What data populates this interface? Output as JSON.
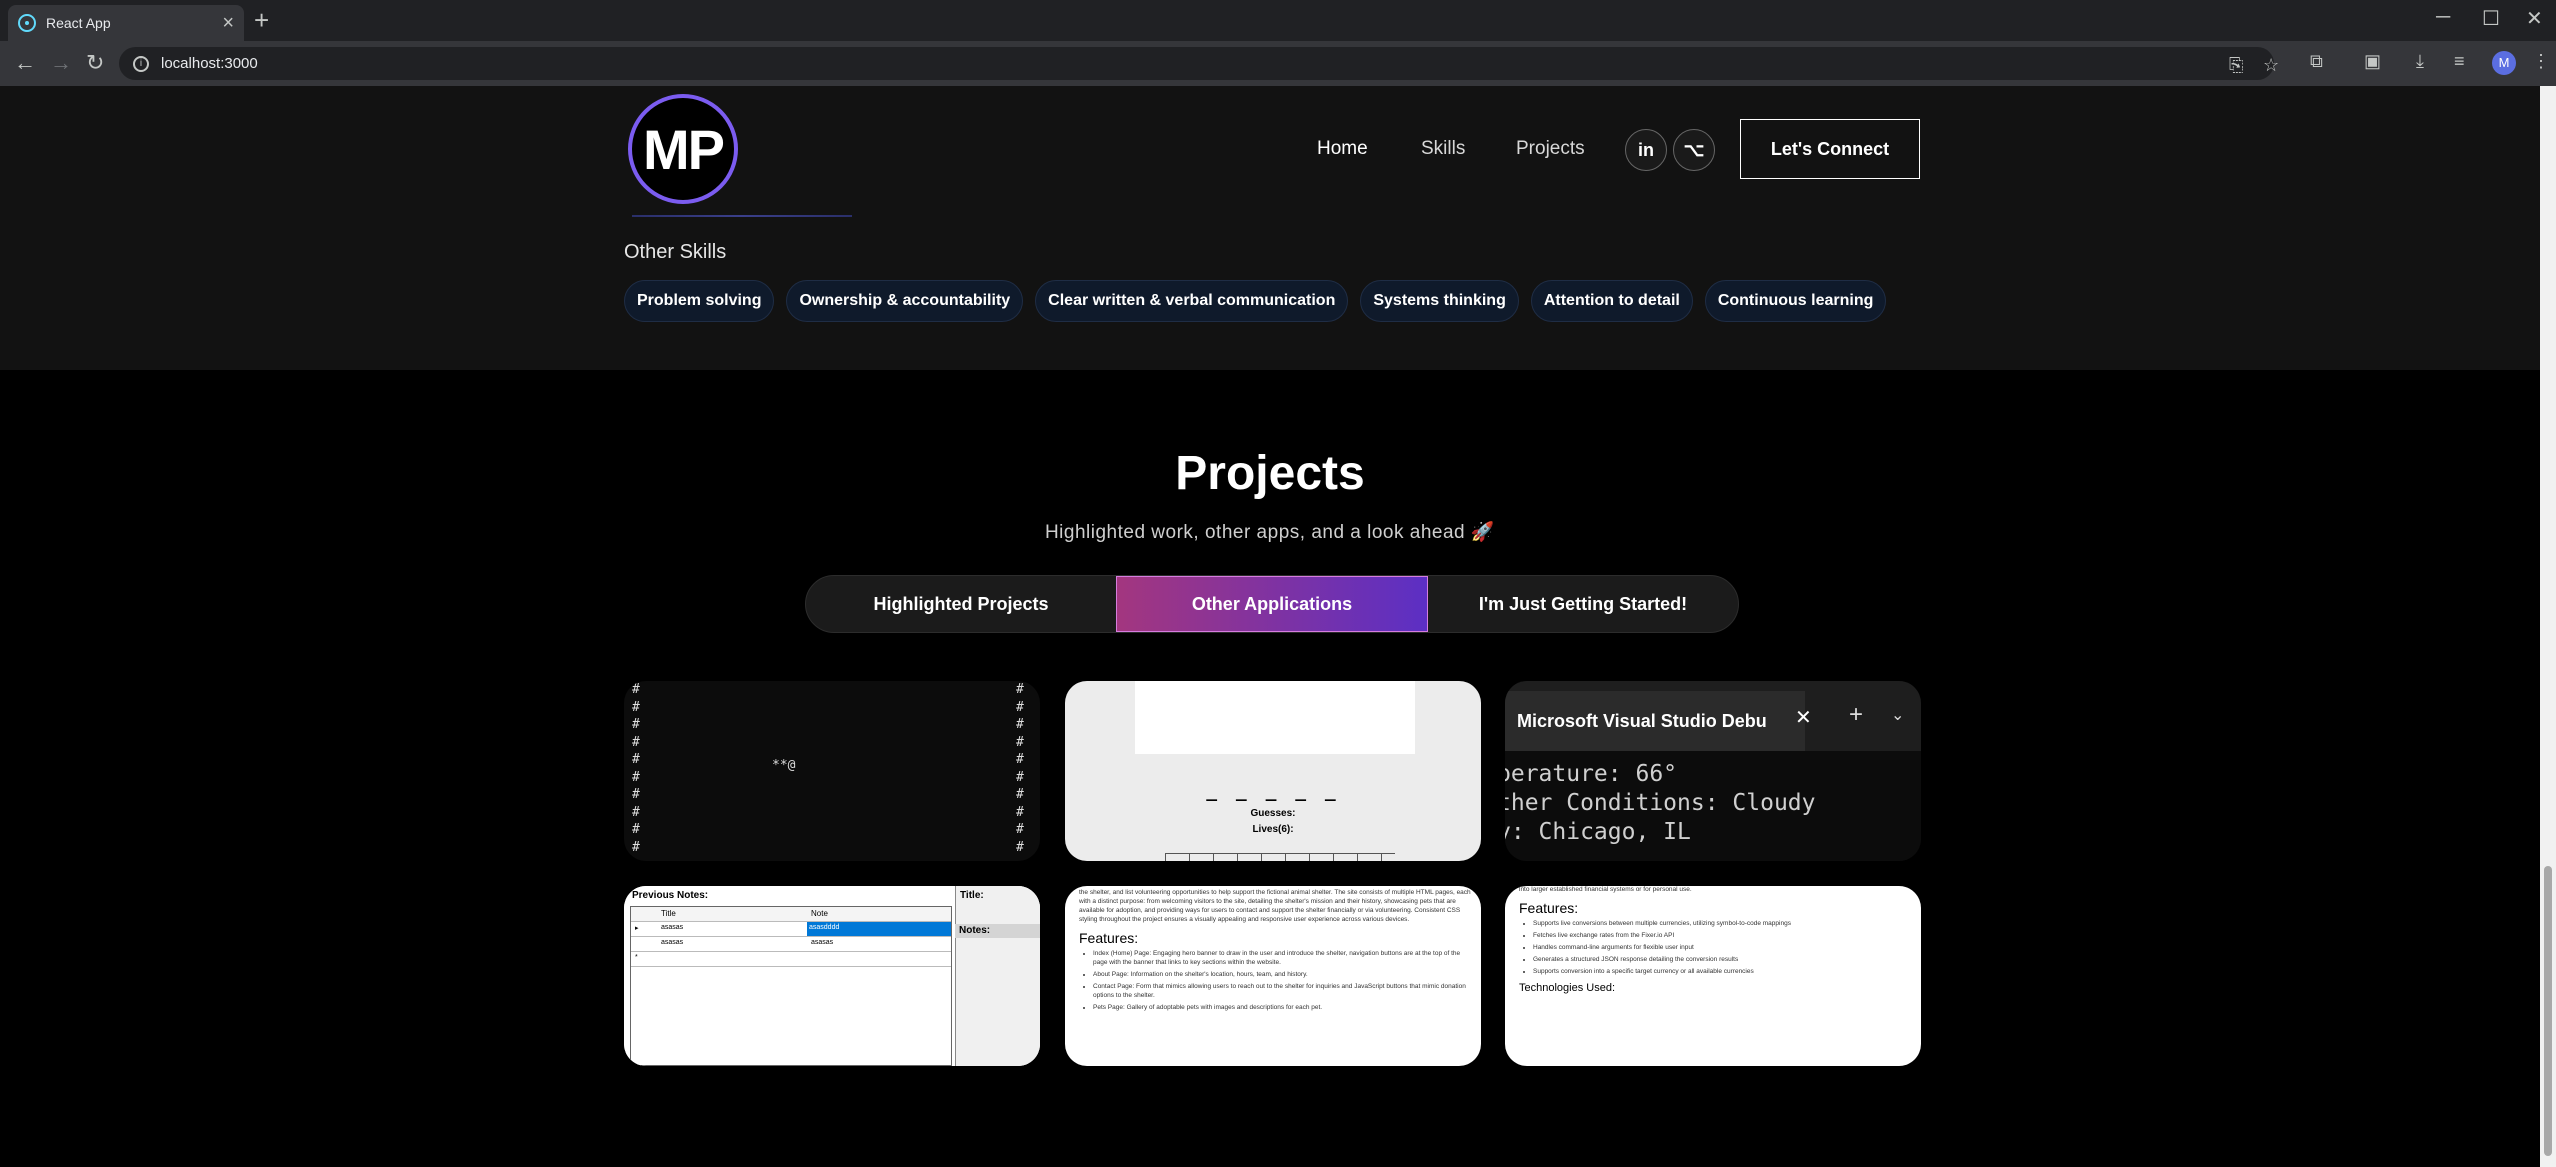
{
  "browser": {
    "tab_title": "React App",
    "url": "localhost:3000",
    "profile_initial": "M"
  },
  "nav": {
    "logo_text": "MP",
    "links": [
      "Home",
      "Skills",
      "Projects"
    ],
    "social": [
      "in",
      "⌥"
    ],
    "connect_label": "Let's Connect"
  },
  "skills": {
    "other_title": "Other Skills",
    "chips": [
      "Problem solving",
      "Ownership & accountability",
      "Clear written & verbal communication",
      "Systems thinking",
      "Attention to detail",
      "Continuous learning"
    ]
  },
  "projects": {
    "title": "Projects",
    "subtitle": "Highlighted work, other apps, and a look ahead 🚀",
    "tabs": [
      "Highlighted Projects",
      "Other Applications",
      "I'm Just Getting Started!"
    ],
    "active_tab": "Other Applications",
    "card1": {
      "snake": "**@"
    },
    "card2": {
      "dashes": "_ _ _ _ _",
      "guesses": "Guesses:",
      "lives": "Lives(6):"
    },
    "card3": {
      "tab_title": "Microsoft Visual Studio Debug",
      "lines": [
        "perature: 66°",
        "ther Conditions: Cloudy",
        "y: Chicago, IL"
      ]
    },
    "card4": {
      "previous_notes": "Previous Notes:",
      "title_col": "Title",
      "note_col": "Note",
      "title_label": "Title:",
      "notes_label": "Notes:",
      "row1_title": "asasas",
      "row1_note": "asasdddd",
      "row2_title": "asasas",
      "row2_note": "asasas"
    },
    "card5": {
      "intro": "the shelter, and list volunteering opportunities to help support the fictional animal shelter. The site consists of multiple HTML pages, each with a distinct purpose: from welcoming visitors to the site, detailing the shelter's mission and their history, showcasing pets that are available for adoption, and providing ways for users to contact and support the shelter financially or via volunteering. Consistent CSS styling throughout the project ensures a visually appealing and responsive user experience across various devices.",
      "features_title": "Features:",
      "features": [
        "Index (Home) Page: Engaging hero banner to draw in the user and introduce the shelter, navigation buttons are at the top of the page with the banner that links to key sections within the website.",
        "About Page: Information on the shelter's location, hours, team, and history.",
        "Contact Page: Form that mimics allowing users to reach out to the shelter for inquiries and JavaScript buttons that mimic donation options to the shelter.",
        "Pets Page: Gallery of adoptable pets with images and descriptions for each pet."
      ]
    },
    "card6": {
      "intro": "produces user-friendly data representations. Making it easy to use for users of any tech level and allowing it to be suitable for integration into larger established financial systems or for personal use.",
      "features_title": "Features:",
      "features": [
        "Supports live conversions between multiple currencies, utilizing symbol-to-code mappings",
        "Fetches live exchange rates from the Fixer.io API",
        "Handles command-line arguments for flexible user input",
        "Generates a structured JSON response detailing the conversion results",
        "Supports conversion into a specific target currency or all available currencies"
      ],
      "tech_title": "Technologies Used:"
    }
  }
}
